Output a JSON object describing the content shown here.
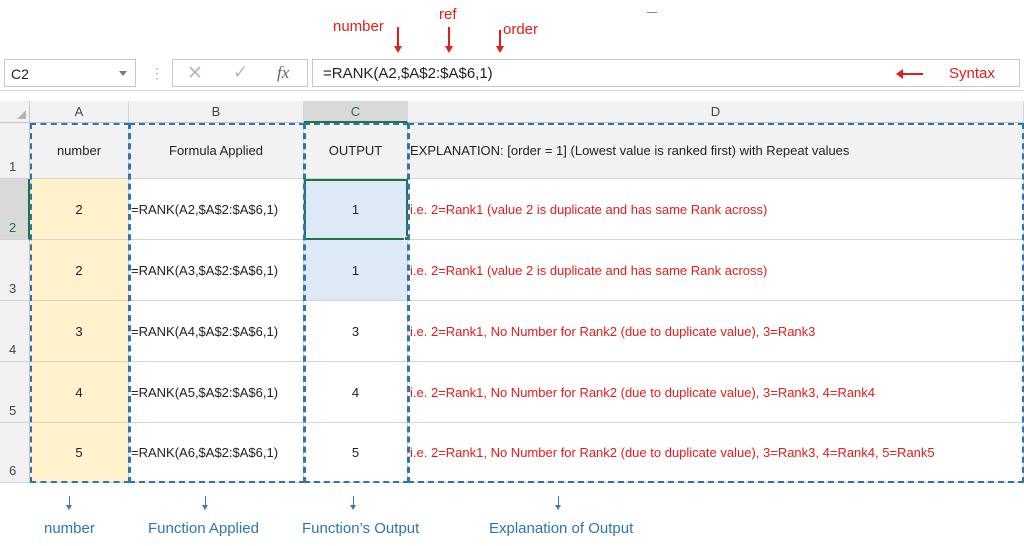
{
  "annotations": {
    "number": "number",
    "ref": "ref",
    "order": "order",
    "syntax": "Syntax"
  },
  "formula_bar": {
    "name_box": "C2",
    "cancel_icon": "cancel-icon",
    "enter_icon": "check-icon",
    "fx_label": "fx",
    "formula": "=RANK(A2,$A$2:$A$6,1)"
  },
  "columns": [
    "A",
    "B",
    "C",
    "D"
  ],
  "rows": [
    "1",
    "2",
    "3",
    "4",
    "5",
    "6"
  ],
  "table": {
    "header": {
      "a": "number",
      "b": "Formula Applied",
      "c": "OUTPUT",
      "d": "EXPLANATION: [order = 1] (Lowest value is ranked first) with Repeat values"
    },
    "data": [
      {
        "a": "2",
        "b": "=RANK(A2,$A$2:$A$6,1)",
        "c": "1",
        "d": "i.e. 2=Rank1 (value 2 is duplicate and has same Rank across)"
      },
      {
        "a": "2",
        "b": "=RANK(A3,$A$2:$A$6,1)",
        "c": "1",
        "d": "i.e. 2=Rank1 (value 2 is duplicate and has same Rank across)"
      },
      {
        "a": "3",
        "b": "=RANK(A4,$A$2:$A$6,1)",
        "c": "3",
        "d": "i.e. 2=Rank1, No Number for Rank2 (due to duplicate value), 3=Rank3"
      },
      {
        "a": "4",
        "b": "=RANK(A5,$A$2:$A$6,1)",
        "c": "4",
        "d": "i.e. 2=Rank1, No Number for Rank2 (due to duplicate value), 3=Rank3, 4=Rank4"
      },
      {
        "a": "5",
        "b": "=RANK(A6,$A$2:$A$6,1)",
        "c": "5",
        "d": "i.e. 2=Rank1, No Number for Rank2 (due to duplicate value), 3=Rank3, 4=Rank4, 5=Rank5"
      }
    ]
  },
  "bottom_labels": {
    "number": "number",
    "function_applied": "Function Applied",
    "function_output": "Function’s Output",
    "explanation": "Explanation of Output"
  },
  "colors": {
    "annotation_red": "#e31c1c",
    "label_blue": "#2e74b5",
    "excel_green": "#217346",
    "highlight_yellow": "#fff2cc",
    "highlight_blue": "#dde9f7"
  }
}
